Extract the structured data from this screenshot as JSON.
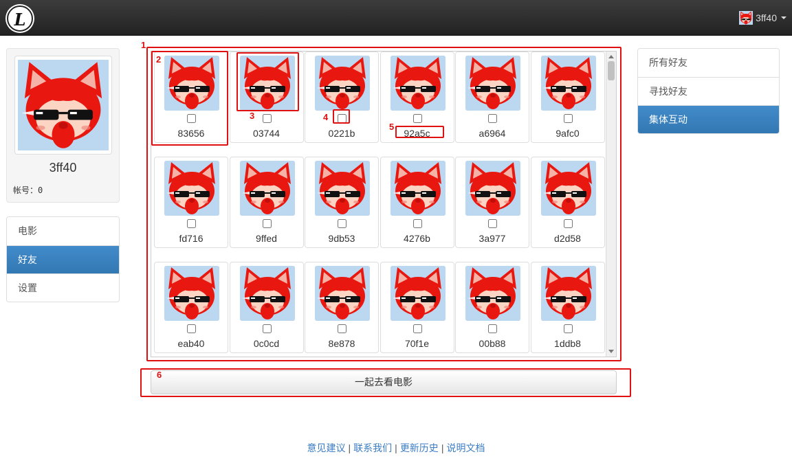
{
  "header": {
    "logo_letter": "L",
    "username": "3ff40"
  },
  "profile": {
    "name": "3ff40",
    "account": "帐号：0"
  },
  "left_nav": [
    {
      "label": "电影",
      "active": false
    },
    {
      "label": "好友",
      "active": true
    },
    {
      "label": "设置",
      "active": false
    }
  ],
  "right_nav": [
    {
      "label": "所有好友",
      "active": false
    },
    {
      "label": "寻找好友",
      "active": false
    },
    {
      "label": "集体互动",
      "active": true
    }
  ],
  "friends": [
    "83656",
    "03744",
    "0221b",
    "92a5c",
    "a6964",
    "9afc0",
    "fd716",
    "9ffed",
    "9db53",
    "4276b",
    "3a977",
    "d2d58",
    "eab40",
    "0c0cd",
    "8e878",
    "70f1e",
    "00b88",
    "1ddb8"
  ],
  "action_button": "一起去看电影",
  "footer": {
    "links": [
      "意见建议",
      "联系我们",
      "更新历史",
      "说明文档"
    ],
    "separator": "|"
  },
  "annotations": [
    "1",
    "2",
    "3",
    "4",
    "5",
    "6"
  ],
  "colors": {
    "navbar": "#2b2b2b",
    "active_nav": "#428bca",
    "annotation": "#e01010",
    "link": "#3b7dc4"
  },
  "icons": {
    "avatar": "red-fox-with-sunglasses",
    "caret": "chevron-down-icon"
  }
}
